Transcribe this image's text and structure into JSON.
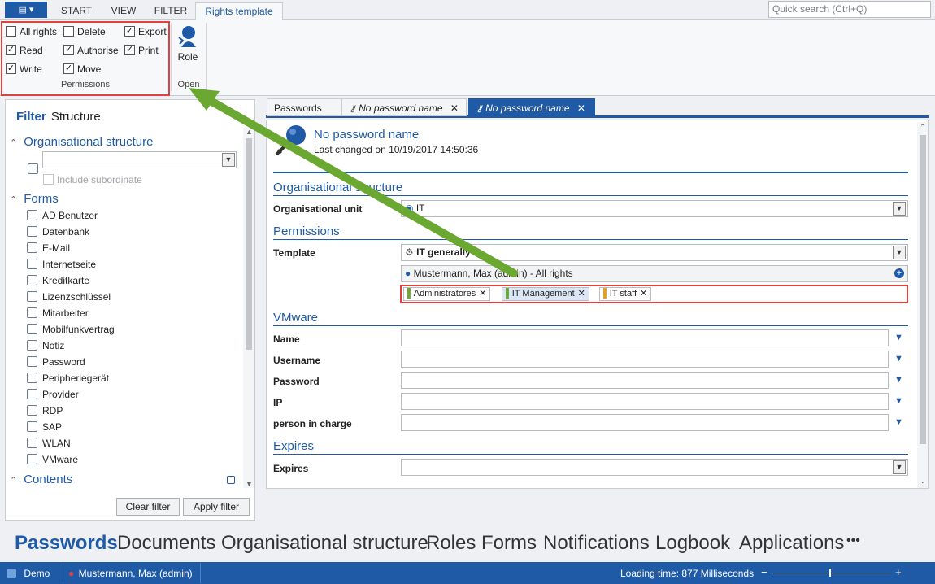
{
  "ribbon": {
    "tabs": [
      "START",
      "VIEW",
      "FILTER",
      "Rights template"
    ],
    "active_tab": "Rights template",
    "search_placeholder": "Quick search (Ctrl+Q)",
    "permissions": [
      {
        "label": "All rights",
        "checked": false
      },
      {
        "label": "Delete",
        "checked": false
      },
      {
        "label": "Export",
        "checked": true
      },
      {
        "label": "Read",
        "checked": true
      },
      {
        "label": "Authorise",
        "checked": true
      },
      {
        "label": "Print",
        "checked": true
      },
      {
        "label": "Write",
        "checked": true
      },
      {
        "label": "Move",
        "checked": true
      }
    ],
    "permissions_group_label": "Permissions",
    "role_label": "Role",
    "open_group_label": "Open"
  },
  "left": {
    "filter_title": "Filter",
    "structure_title": "Structure",
    "org_section": "Organisational structure",
    "include_subordinate": "Include subordinate",
    "forms_section": "Forms",
    "forms": [
      "AD Benutzer",
      "Datenbank",
      "E-Mail",
      "Internetseite",
      "Kreditkarte",
      "Lizenzschlüssel",
      "Mitarbeiter",
      "Mobilfunkvertrag",
      "Notiz",
      "Password",
      "Peripheriegerät",
      "Provider",
      "RDP",
      "SAP",
      "WLAN",
      "VMware"
    ],
    "contents_section": "Contents",
    "clear_filter": "Clear filter",
    "apply_filter": "Apply filter"
  },
  "doc_tabs": [
    "Passwords",
    "No password name",
    "No password name"
  ],
  "record": {
    "title": "No password name",
    "last_changed": "Last changed on 10/19/2017 14:50:36",
    "org_header": "Organisational structure",
    "org_unit_label": "Organisational unit",
    "org_unit_value": "IT",
    "perm_header": "Permissions",
    "template_label": "Template",
    "template_value": "IT generally",
    "owner_value": "Mustermann, Max (admin) - All rights",
    "tags": [
      "Administratores",
      "IT Management",
      "IT staff"
    ],
    "vmware_header": "VMware",
    "vm_fields": [
      "Name",
      "Username",
      "Password",
      "IP",
      "person in charge"
    ],
    "expires_header": "Expires",
    "expires_label": "Expires"
  },
  "modules": [
    "Passwords",
    "Documents",
    "Organisational structure",
    "Roles",
    "Forms",
    "Notifications",
    "Logbook",
    "Applications",
    "•••"
  ],
  "status": {
    "database": "Demo",
    "user": "Mustermann, Max (admin)",
    "loading": "Loading time: 877 Milliseconds",
    "zoom_minus": "−",
    "zoom_plus": "+"
  },
  "colors": {
    "accent": "#1f5aa6",
    "highlight": "#e04040",
    "arrow": "#6aa832"
  }
}
